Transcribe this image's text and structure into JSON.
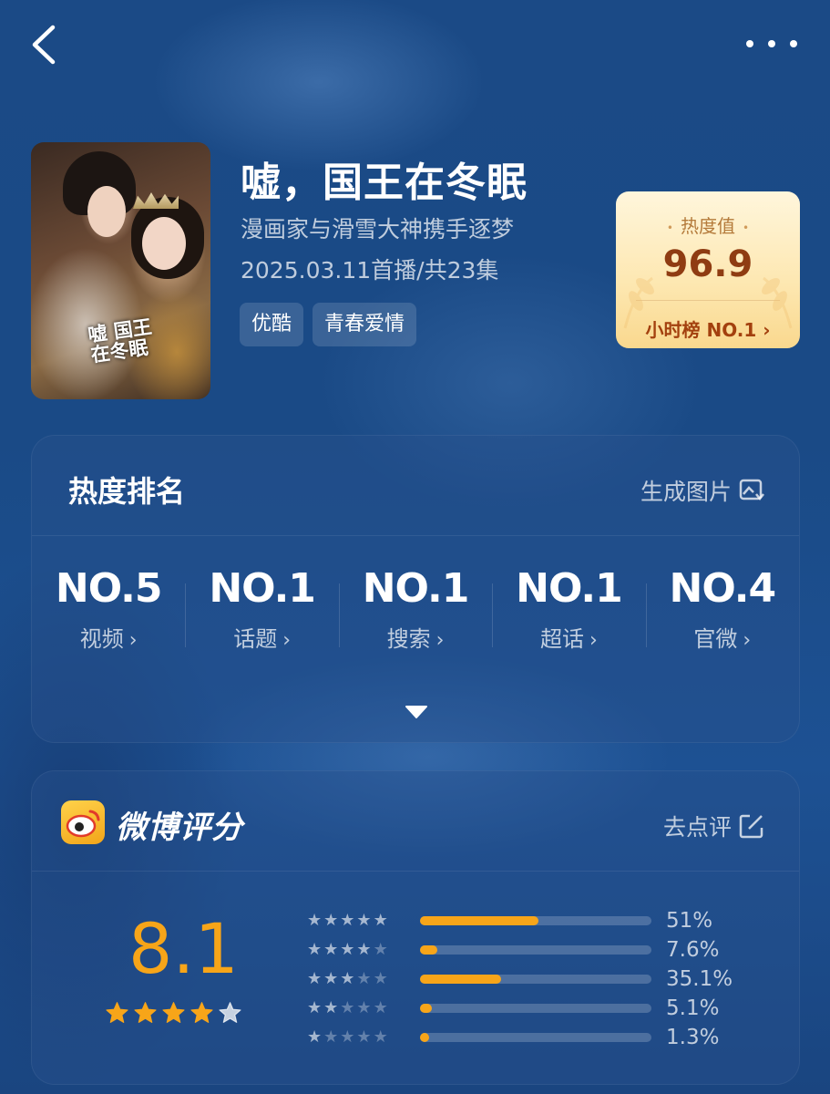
{
  "header": {
    "back_icon": "chevron-left-icon",
    "more_icon": "more-dots-icon"
  },
  "show": {
    "title": "嘘，国王在冬眠",
    "subtitle": "漫画家与滑雪大神携手逐梦",
    "meta": "2025.03.11首播/共23集",
    "poster_logo": "嘘国王在冬眠",
    "tags": [
      "优酷",
      "青春爱情"
    ]
  },
  "heat_card": {
    "label": "热度值",
    "value": "96.9",
    "rank_text": "小时榜 NO.1",
    "chevron": "›"
  },
  "ranking": {
    "title": "热度排名",
    "action_label": "生成图片",
    "action_icon": "image-download-icon",
    "items": [
      {
        "no": "NO.5",
        "label": "视频"
      },
      {
        "no": "NO.1",
        "label": "话题"
      },
      {
        "no": "NO.1",
        "label": "搜索"
      },
      {
        "no": "NO.1",
        "label": "超话"
      },
      {
        "no": "NO.4",
        "label": "官微"
      }
    ],
    "chevron": "›",
    "expand_icon": "triangle-down-icon"
  },
  "weibo": {
    "title": "微博评分",
    "logo_icon": "weibo-logo-icon",
    "action_label": "去点评",
    "action_icon": "edit-icon",
    "score": "8.1",
    "score_stars_filled": 4,
    "accent": "#f7a519",
    "distribution": [
      {
        "stars": 5,
        "percent": "51%",
        "value": 51
      },
      {
        "stars": 4,
        "percent": "7.6%",
        "value": 7.6
      },
      {
        "stars": 3,
        "percent": "35.1%",
        "value": 35.1
      },
      {
        "stars": 2,
        "percent": "5.1%",
        "value": 5.1
      },
      {
        "stars": 1,
        "percent": "1.3%",
        "value": 1.3
      }
    ]
  }
}
